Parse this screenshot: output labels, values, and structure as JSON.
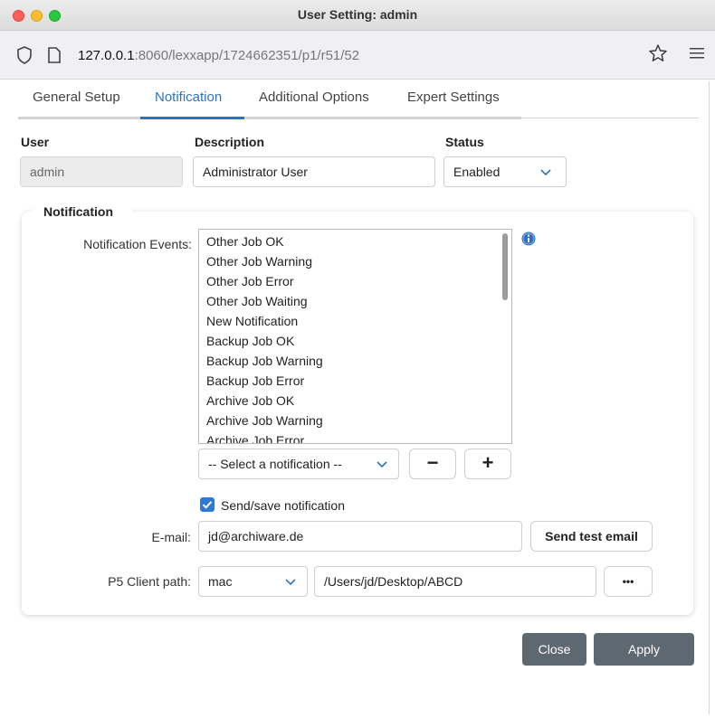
{
  "window": {
    "title": "User Setting: admin"
  },
  "browser": {
    "url_host": "127.0.0.1",
    "url_rest": ":8060/lexxapp/1724662351/p1/r51/52"
  },
  "tabs": [
    {
      "label": "General Setup",
      "active": false
    },
    {
      "label": "Notification",
      "active": true
    },
    {
      "label": "Additional Options",
      "active": false
    },
    {
      "label": "Expert Settings",
      "active": false
    }
  ],
  "user_row": {
    "user_label": "User",
    "user_value": "admin",
    "description_label": "Description",
    "description_value": "Administrator User",
    "status_label": "Status",
    "status_value": "Enabled"
  },
  "notification": {
    "section_title": "Notification",
    "events_label": "Notification Events:",
    "events": [
      "Other Job OK",
      "Other Job Warning",
      "Other Job Error",
      "Other Job Waiting",
      "New Notification",
      "Backup Job OK",
      "Backup Job Warning",
      "Backup Job Error",
      "Archive Job OK",
      "Archive Job Warning",
      "Archive Job Error"
    ],
    "select_placeholder": "-- Select a notification --",
    "remove_symbol": "−",
    "add_symbol": "+",
    "send_save_label": "Send/save notification",
    "send_save_checked": true,
    "email_label": "E-mail:",
    "email_value": "jd@archiware.de",
    "send_test_label": "Send test email",
    "client_path_label": "P5 Client path:",
    "client_os_value": "mac",
    "client_path_value": "/Users/jd/Desktop/ABCD",
    "browse_label": "•••"
  },
  "footer": {
    "close_label": "Close",
    "apply_label": "Apply"
  },
  "colors": {
    "accent": "#2e74c0",
    "dark_button": "#5e6870"
  }
}
